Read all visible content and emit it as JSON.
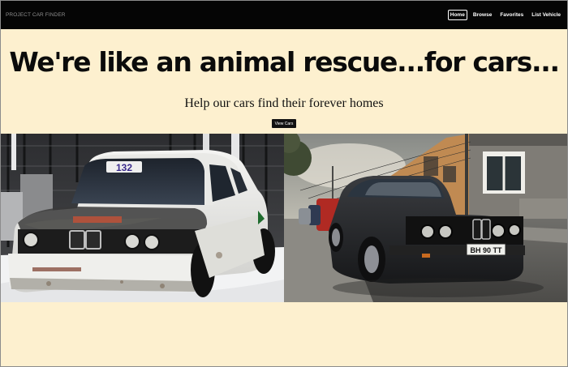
{
  "brand": "PROJECT CAR FINDER",
  "nav": {
    "home": "Home",
    "browse": "Browse",
    "favorites": "Favorites",
    "list_vehicle": "List Vehicle"
  },
  "hero": {
    "title": "We're like an animal rescue...for cars...",
    "subtitle": "Help our cars find their forever homes",
    "button": "View Cars"
  },
  "images": {
    "left_car_number": "132",
    "right_car_plate": "BH 90 TT"
  },
  "colors": {
    "background": "#fdf0cf",
    "navbar": "#050505",
    "button": "#111111"
  }
}
